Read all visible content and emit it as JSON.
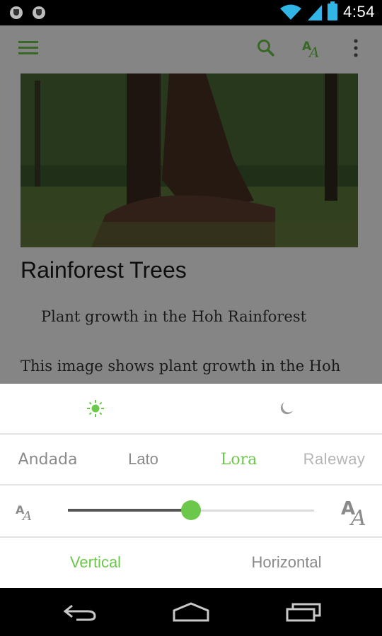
{
  "status_bar": {
    "time": "4:54"
  },
  "article": {
    "title": "Rainforest Trees",
    "caption": "Plant growth in the Hoh Rainforest",
    "body": "This image shows plant growth in the Hoh"
  },
  "sheet": {
    "fonts": [
      "Andada",
      "Lato",
      "Lora",
      "Raleway"
    ],
    "selected_font": "Lora",
    "text_size_level": 0.5,
    "orientation": {
      "vertical": "Vertical",
      "horizontal": "Horizontal",
      "selected": "Vertical"
    }
  },
  "colors": {
    "accent": "#6cc84a",
    "inactive": "#8a8a8a"
  },
  "icons": [
    "menu-icon",
    "search-icon",
    "text-size-icon",
    "overflow-icon",
    "sun-icon",
    "moon-icon",
    "back-icon",
    "home-icon",
    "recents-icon"
  ]
}
